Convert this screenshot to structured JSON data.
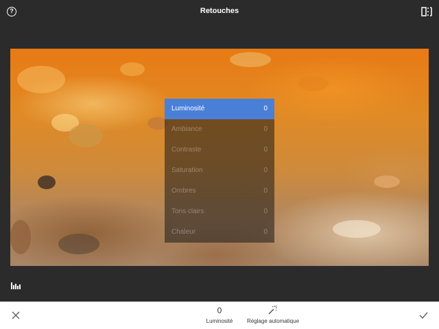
{
  "header": {
    "title": "Retouches",
    "help_icon": "question-mark-icon",
    "compare_icon": "split-compare-icon",
    "help_glyph": "?"
  },
  "adjust_menu": {
    "items": [
      {
        "label": "Luminosité",
        "value": "0",
        "selected": true
      },
      {
        "label": "Ambiance",
        "value": "0",
        "selected": false
      },
      {
        "label": "Contraste",
        "value": "0",
        "selected": false
      },
      {
        "label": "Saturation",
        "value": "0",
        "selected": false
      },
      {
        "label": "Ombres",
        "value": "0",
        "selected": false
      },
      {
        "label": "Tons clairs",
        "value": "0",
        "selected": false
      },
      {
        "label": "Chaleur",
        "value": "0",
        "selected": false
      }
    ],
    "selected_color": "#4a7fd8"
  },
  "footer": {
    "cancel_icon": "close-icon",
    "value": "0",
    "param_name": "Luminosité",
    "auto_icon": "magic-wand-icon",
    "auto_label": "Réglage automatique",
    "apply_icon": "checkmark-icon",
    "histogram_icon": "histogram-icon"
  },
  "colors": {
    "background": "#2b2b2b",
    "bottom_bar": "#ffffff",
    "accent": "#4a7fd8"
  }
}
